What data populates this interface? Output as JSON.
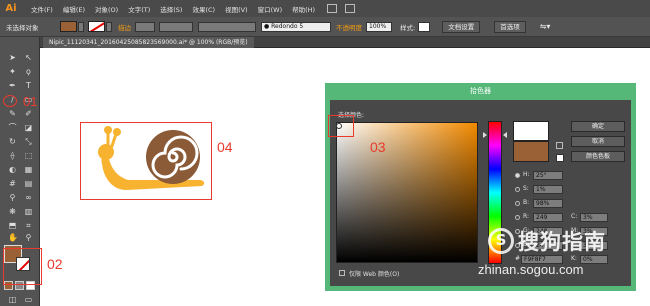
{
  "app": {
    "logo": "Ai"
  },
  "menu": [
    "文件(F)",
    "编辑(E)",
    "对象(O)",
    "文字(T)",
    "选择(S)",
    "效果(C)",
    "视图(V)",
    "窗口(W)",
    "帮助(H)"
  ],
  "control_bar": {
    "selection": "未选择对象",
    "stroke_label": "描边",
    "brush_name": "● Redondo 5",
    "opacity_label": "不透明度",
    "opacity_value": "100%",
    "style_label": "样式:",
    "doc_setup": "文档设置",
    "preferences": "首选项"
  },
  "document": {
    "tab": "Nipic_11120341_20160425085823569000.ai* @ 100% (RGB/预览)"
  },
  "annotations": {
    "a01": "01",
    "a02": "02",
    "a03": "03",
    "a04": "04"
  },
  "colors": {
    "fill": "#9a6136",
    "snail_shell": "#8b5a37",
    "snail_body": "#f7b330",
    "dialog_frame": "#55b879"
  },
  "color_picker": {
    "title": "拾色器",
    "select_color_label": "选择颜色:",
    "buttons": {
      "ok": "确定",
      "cancel": "取消",
      "swatches": "颜色色板"
    },
    "fields": {
      "H": {
        "label": "H:",
        "value": "25°"
      },
      "S": {
        "label": "S:",
        "value": "1%"
      },
      "B": {
        "label": "B:",
        "value": "98%"
      },
      "R": {
        "label": "R:",
        "value": "249"
      },
      "C": {
        "label": "C:",
        "value": "3%"
      },
      "G": {
        "label": "G:",
        "value": "248"
      },
      "M": {
        "label": "M:",
        "value": "3%"
      },
      "Bl": {
        "label": "B:",
        "value": "247"
      },
      "Y": {
        "label": "Y:",
        "value": "3%"
      },
      "K": {
        "label": "K:",
        "value": "0%"
      },
      "hex": {
        "label": "#",
        "value": "F9F8F7"
      }
    },
    "web_only": "仅限 Web 颜色(O)"
  },
  "watermark": {
    "brand": "搜狗指南",
    "url": "zhinan.sogou.com"
  }
}
